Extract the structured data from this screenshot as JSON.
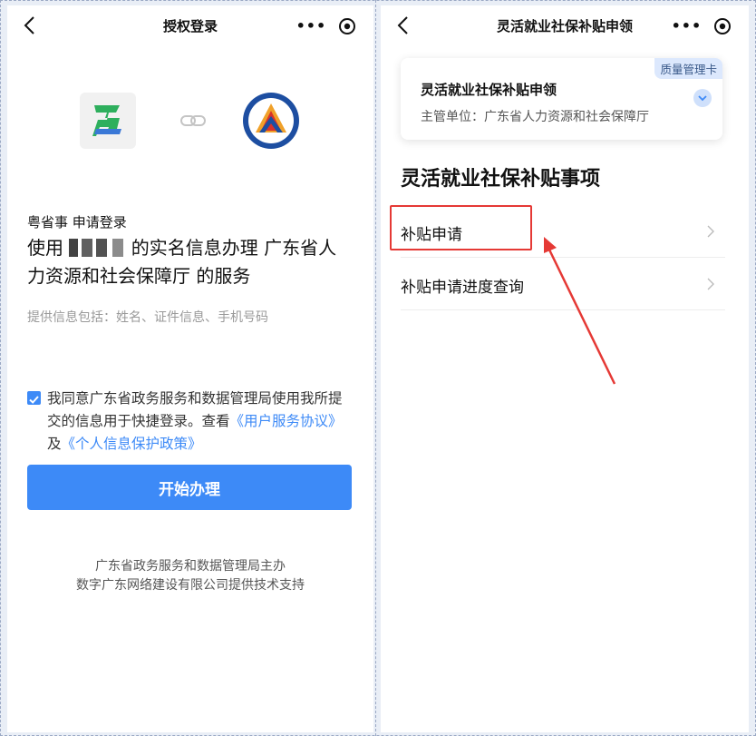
{
  "left": {
    "title": "授权登录",
    "auth_sub": "粤省事 申请登录",
    "auth_main_prefix": "使用",
    "auth_main_suffix": "的实名信息办理 广东省人力资源和社会保障厅 的服务",
    "auth_info": "提供信息包括：姓名、证件信息、手机号码",
    "agree_text": "我同意广东省政务服务和数据管理局使用我所提交的信息用于快捷登录。查看",
    "link_service": "《用户服务协议》",
    "agree_and": "及",
    "link_privacy": "《个人信息保护政策》",
    "start_button": "开始办理",
    "footer_line1": "广东省政务服务和数据管理局主办",
    "footer_line2": "数字广东网络建设有限公司提供技术支持"
  },
  "right": {
    "title": "灵活就业社保补贴申领",
    "card": {
      "tag": "质量管理卡",
      "title": "灵活就业社保补贴申领",
      "subtitle": "主管单位：广东省人力资源和社会保障厅"
    },
    "section_title": "灵活就业社保补贴事项",
    "menu": [
      {
        "label": "补贴申请"
      },
      {
        "label": "补贴申请进度查询"
      }
    ]
  },
  "colors": {
    "accent": "#3d8af7",
    "annotation": "#e53935"
  }
}
